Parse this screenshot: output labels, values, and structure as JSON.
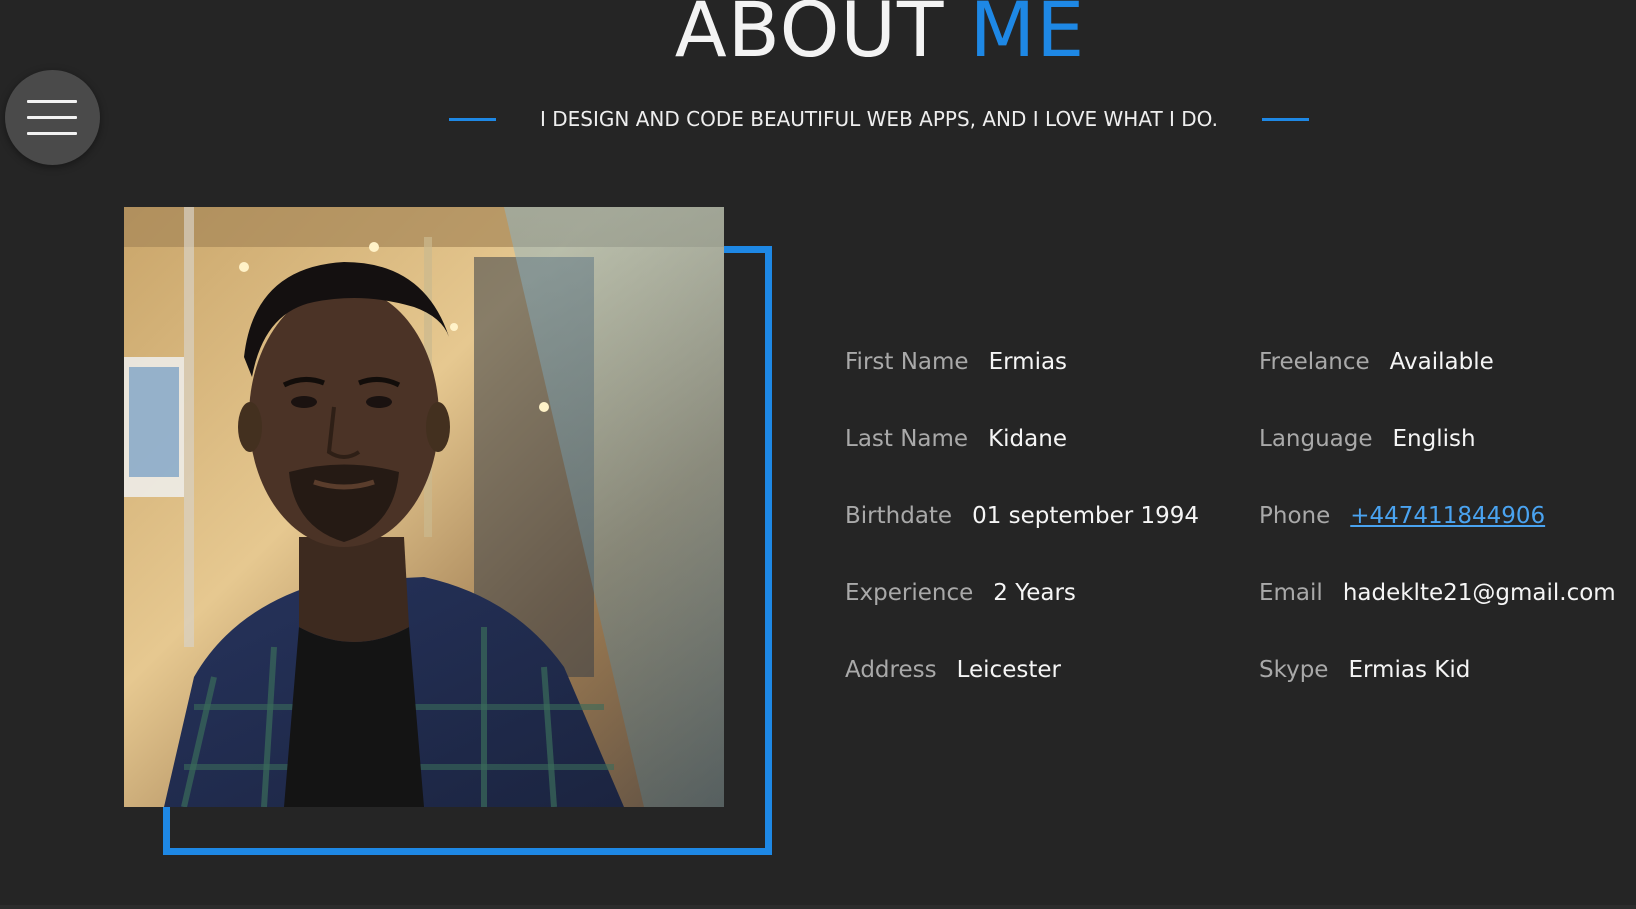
{
  "header": {
    "title_main": "ABOUT",
    "title_accent": "ME",
    "subtitle": "I DESIGN AND CODE BEAUTIFUL WEB APPS, AND I LOVE WHAT I DO."
  },
  "menu": {
    "icon": "hamburger-menu-icon"
  },
  "colors": {
    "accent": "#1e88e5",
    "background": "#252525",
    "link": "#4aa3f0"
  },
  "profile": {
    "left_column": [
      {
        "label": "First Name",
        "value": "Ermias"
      },
      {
        "label": "Last Name",
        "value": "Kidane"
      },
      {
        "label": "Birthdate",
        "value": "01 september 1994"
      },
      {
        "label": "Experience",
        "value": "2 Years"
      },
      {
        "label": "Address",
        "value": "Leicester"
      }
    ],
    "right_column": [
      {
        "label": "Freelance",
        "value": "Available"
      },
      {
        "label": "Language",
        "value": "English"
      },
      {
        "label": "Phone",
        "value": "+447411844906"
      },
      {
        "label": "Email",
        "value": "hadeklte21@gmail.com"
      },
      {
        "label": "Skype",
        "value": "Ermias Kid"
      }
    ]
  }
}
